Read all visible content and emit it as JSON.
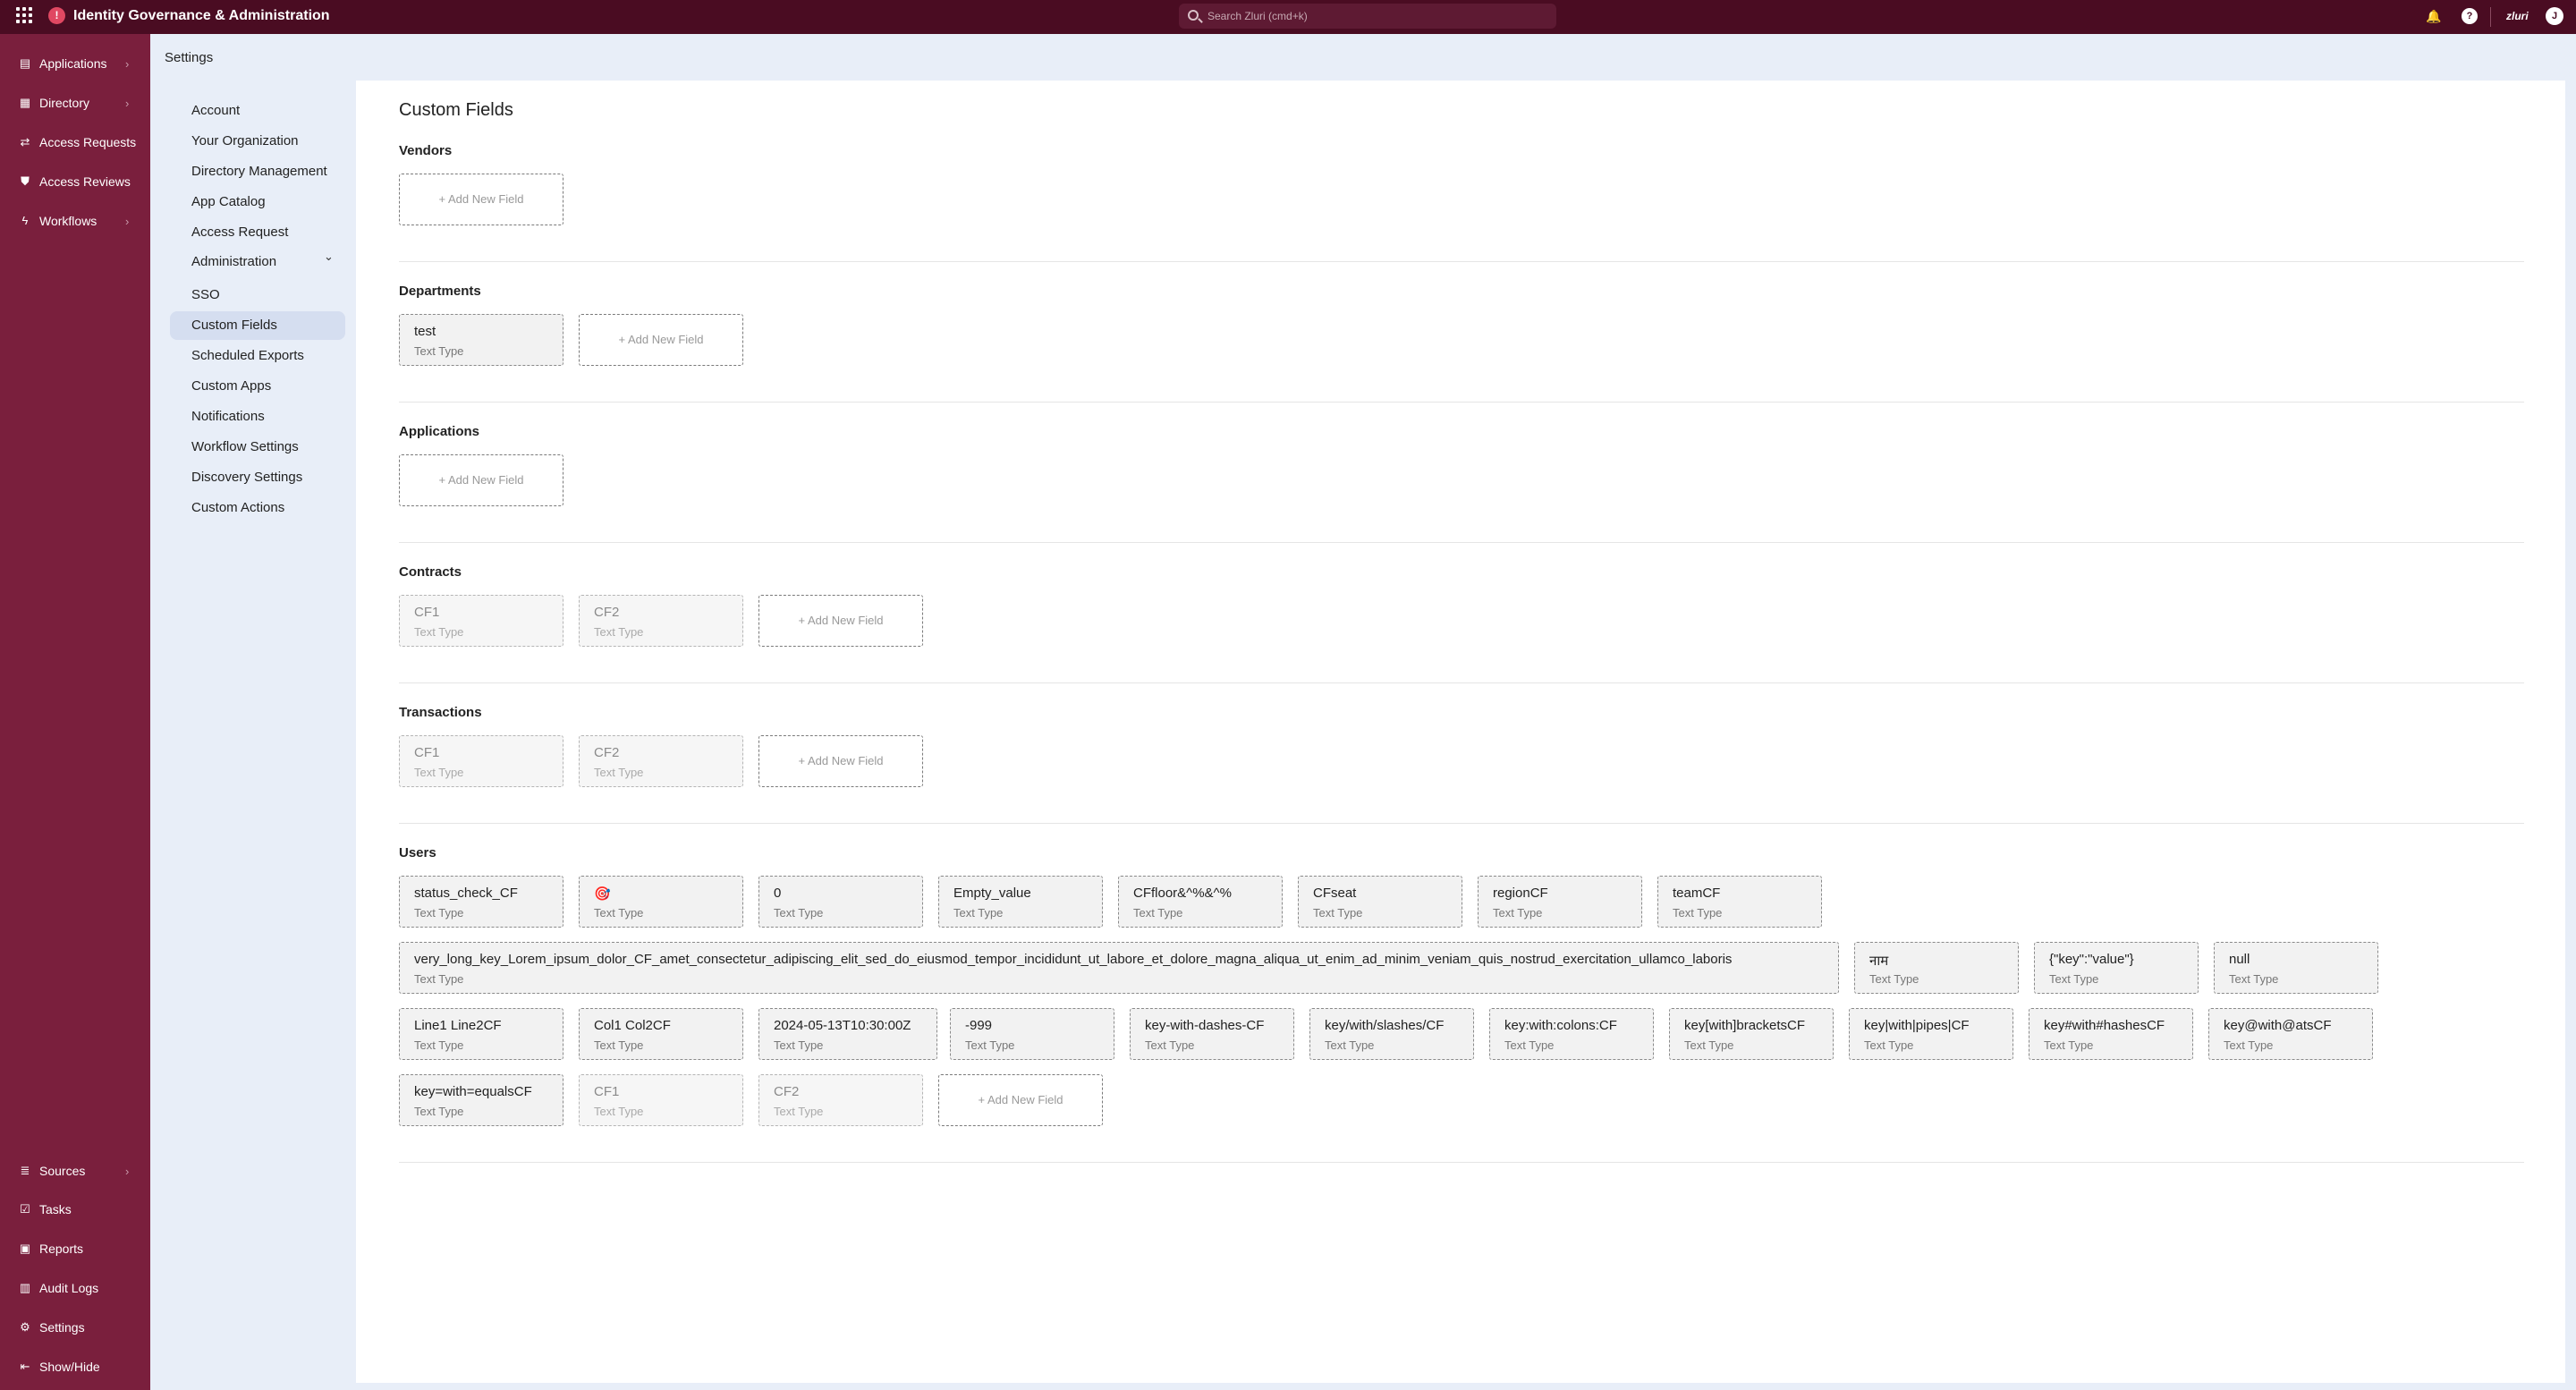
{
  "header": {
    "app_title": "Identity Governance & Administration",
    "search_placeholder": "Search Zluri (cmd+k)",
    "org_label": "zluri",
    "avatar_initial": "J"
  },
  "rail": {
    "top": [
      {
        "label": "Applications",
        "icon": "applications-icon",
        "chevron": true
      },
      {
        "label": "Directory",
        "icon": "directory-icon",
        "chevron": true
      },
      {
        "label": "Access Requests",
        "icon": "access-requests-icon",
        "chevron": false
      },
      {
        "label": "Access Reviews",
        "icon": "shield-icon",
        "chevron": false
      },
      {
        "label": "Workflows",
        "icon": "lightning-icon",
        "chevron": true
      }
    ],
    "bottom": [
      {
        "label": "Sources",
        "icon": "sources-icon",
        "chevron": true
      },
      {
        "label": "Tasks",
        "icon": "tasks-icon",
        "chevron": false
      },
      {
        "label": "Reports",
        "icon": "reports-icon",
        "chevron": false
      },
      {
        "label": "Audit Logs",
        "icon": "audit-logs-icon",
        "chevron": false
      },
      {
        "label": "Settings",
        "icon": "gear-icon",
        "chevron": false
      },
      {
        "label": "Show/Hide",
        "icon": "show-hide-icon",
        "chevron": false
      }
    ]
  },
  "settings": {
    "title": "Settings",
    "nav": [
      {
        "label": "Account"
      },
      {
        "label": "Your Organization"
      },
      {
        "label": "Directory Management"
      },
      {
        "label": "App Catalog"
      },
      {
        "label": "Access Request"
      },
      {
        "label": "Administration"
      },
      {
        "label": "SSO"
      },
      {
        "label": "Custom Fields"
      },
      {
        "label": "Scheduled Exports"
      },
      {
        "label": "Custom Apps"
      },
      {
        "label": "Notifications"
      },
      {
        "label": "Workflow Settings"
      },
      {
        "label": "Discovery Settings"
      },
      {
        "label": "Custom Actions"
      }
    ],
    "active_item": "Custom Fields"
  },
  "main": {
    "page_title": "Custom Fields",
    "add_label": "+ Add New Field",
    "type_label": "Text Type",
    "sections": [
      {
        "title": "Vendors",
        "fields": []
      },
      {
        "title": "Departments",
        "fields": [
          "test"
        ]
      },
      {
        "title": "Applications",
        "fields": []
      },
      {
        "title": "Contracts",
        "fields": [
          "CF1",
          "CF2"
        ]
      },
      {
        "title": "Transactions",
        "fields": [
          "CF1",
          "CF2"
        ]
      },
      {
        "title": "Users",
        "fields": [
          "status_check_CF",
          "🎯",
          "0",
          "Empty_value",
          "CFfloor&^%&^%",
          "CFseat",
          "regionCF",
          "teamCF",
          "very_long_key_Lorem_ipsum_dolor_CF_amet_consectetur_adipiscing_elit_sed_do_eiusmod_tempor_incididunt_ut_labore_et_dolore_magna_aliqua_ut_enim_ad_minim_veniam_quis_nostrud_exercitation_ullamco_laboris",
          "नाम",
          "{\"key\":\"value\"}",
          "null",
          "Line1 Line2CF",
          "Col1 Col2CF",
          "2024-05-13T10:30:00Z",
          "-999",
          "key-with-dashes-CF",
          "key/with/slashes/CF",
          "key:with:colons:CF",
          "key[with]bracketsCF",
          "key|with|pipes|CF",
          "key#with#hashesCF",
          "key@with@atsCF",
          "key=with=equalsCF",
          "CF1",
          "CF2"
        ]
      }
    ]
  }
}
